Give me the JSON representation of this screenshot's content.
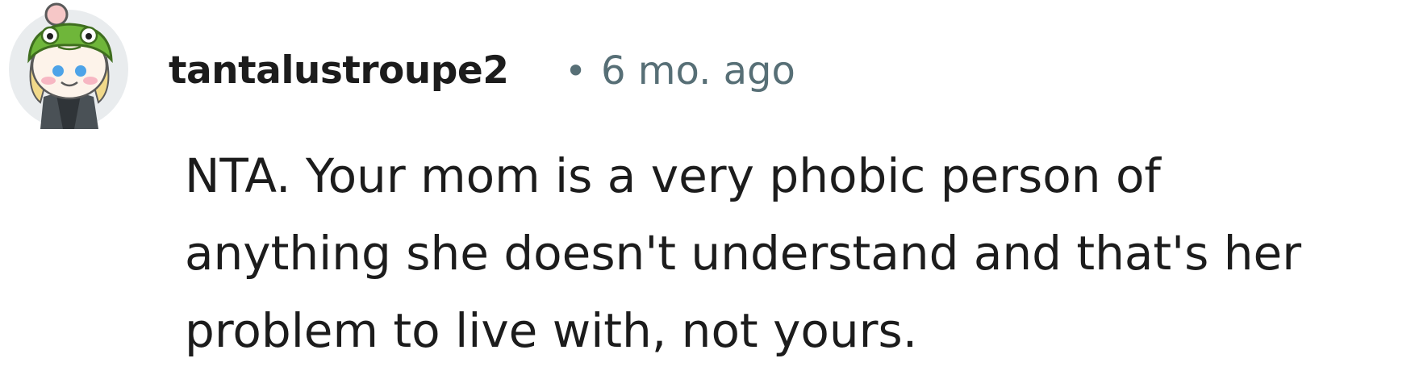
{
  "comment": {
    "avatar_icon": "snoo-frog-hat-avatar-icon",
    "username": "tantalustroupe2",
    "separator": "•",
    "timestamp": "6 mo. ago",
    "body": "NTA. Your mom is a very phobic person of anything she doesn't understand and that's her problem to live with, not yours."
  },
  "colors": {
    "username": "#1c1c1c",
    "meta": "#576f76",
    "body_text": "#1c1c1c",
    "avatar_bg": "#e9ecee",
    "frog_hat": "#6fb63a"
  }
}
